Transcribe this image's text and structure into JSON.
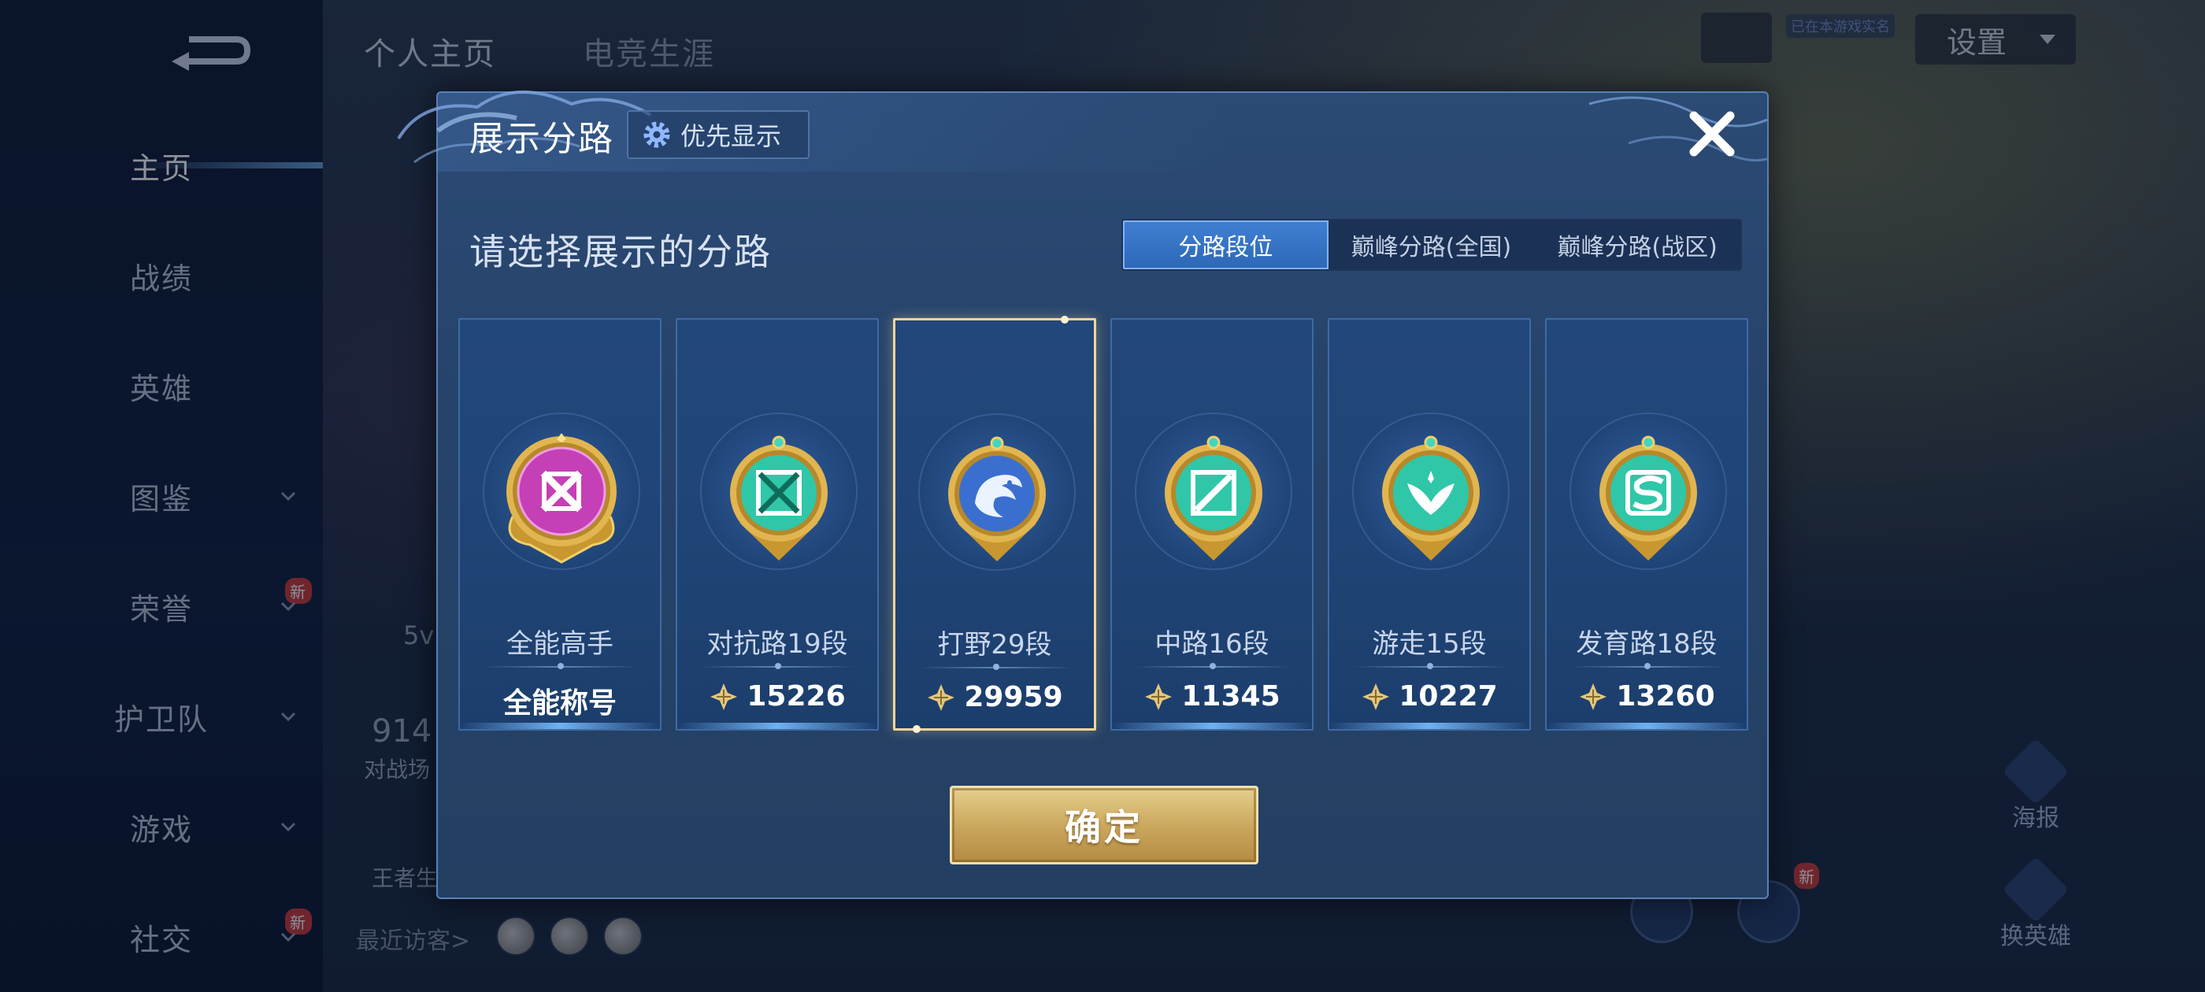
{
  "sidebar": {
    "items": [
      {
        "label": "主页",
        "active": true
      },
      {
        "label": "战绩"
      },
      {
        "label": "英雄"
      },
      {
        "label": "图鉴",
        "has_chevron": true
      },
      {
        "label": "荣誉",
        "has_chevron": true,
        "badge": "新"
      },
      {
        "label": "护卫队",
        "has_chevron": true
      },
      {
        "label": "游戏",
        "has_chevron": true
      },
      {
        "label": "社交",
        "has_chevron": true,
        "badge": "新"
      }
    ]
  },
  "top_tabs": [
    {
      "label": "个人主页",
      "active": true
    },
    {
      "label": "电竞生涯"
    }
  ],
  "top_right": {
    "settings_label": "设置",
    "qq_status": "已在本游戏实名"
  },
  "background": {
    "mode_text": "5v",
    "stat_number": "914",
    "stat_label": "对战场",
    "king_label": "王者生",
    "visitors_label": "最近访客>",
    "poster_label": "海报",
    "swap_hero_label": "换英雄",
    "new_badge": "新"
  },
  "dialog": {
    "title": "展示分路",
    "priority_button": "优先显示",
    "subtitle": "请选择展示的分路",
    "segments": [
      {
        "label": "分路段位",
        "active": true
      },
      {
        "label": "巅峰分路(全国)"
      },
      {
        "label": "巅峰分路(战区)"
      }
    ],
    "cards": [
      {
        "name": "全能高手",
        "value": "全能称号",
        "icon": "all-round-emblem-icon",
        "color": "#c53fb6",
        "selected": false
      },
      {
        "name": "对抗路19段",
        "value": "15226",
        "icon": "clash-lane-emblem-icon",
        "color": "#2fc7a8",
        "selected": false
      },
      {
        "name": "打野29段",
        "value": "29959",
        "icon": "jungle-emblem-icon",
        "color": "#3a6fd0",
        "selected": true
      },
      {
        "name": "中路16段",
        "value": "11345",
        "icon": "mid-lane-emblem-icon",
        "color": "#2fc7a8",
        "selected": false
      },
      {
        "name": "游走15段",
        "value": "10227",
        "icon": "roam-emblem-icon",
        "color": "#2fc7a8",
        "selected": false
      },
      {
        "name": "发育路18段",
        "value": "13260",
        "icon": "farm-lane-emblem-icon",
        "color": "#2fc7a8",
        "selected": false
      }
    ],
    "confirm_button": "确定"
  },
  "colors": {
    "gold": "#e6cf8c",
    "accent_blue": "#3f7fd2",
    "dialog_bg": "#26436a"
  }
}
